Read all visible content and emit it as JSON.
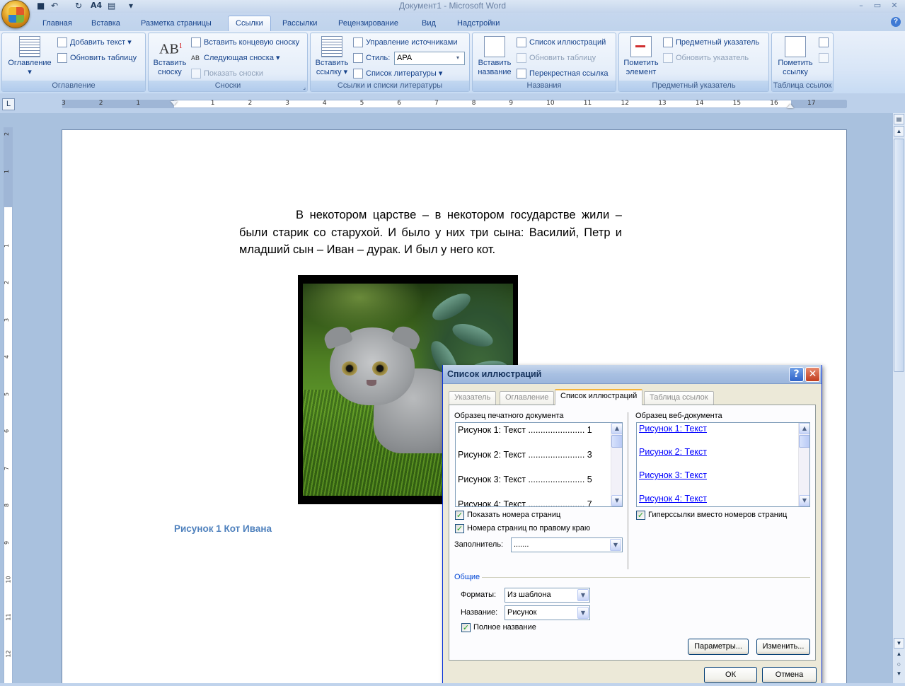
{
  "window": {
    "title": "Документ1 - Microsoft Word",
    "controls": {
      "minimize": "–",
      "restore": "▭",
      "close": "✕"
    }
  },
  "qat": {
    "save": "■",
    "undo": "↶",
    "redo": "↻",
    "font_size": "A4",
    "customize": "▾"
  },
  "tabs": [
    "Главная",
    "Вставка",
    "Разметка страницы",
    "Ссылки",
    "Рассылки",
    "Рецензирование",
    "Вид",
    "Надстройки"
  ],
  "active_tab": "Ссылки",
  "ribbon": {
    "groups": [
      {
        "label": "Оглавление",
        "big": "Оглавление",
        "small": [
          "Добавить текст",
          "Обновить таблицу"
        ]
      },
      {
        "label": "Сноски",
        "big_line1": "Вставить",
        "big_line2": "сноску",
        "small": [
          "Вставить концевую сноску",
          "Следующая сноска",
          "Показать сноски"
        ]
      },
      {
        "label": "Ссылки и списки литературы",
        "big_line1": "Вставить",
        "big_line2": "ссылку",
        "small": [
          "Управление источниками",
          "Стиль:",
          "Список литературы"
        ],
        "style_value": "APA"
      },
      {
        "label": "Названия",
        "big_line1": "Вставить",
        "big_line2": "название",
        "small": [
          "Список иллюстраций",
          "Обновить таблицу",
          "Перекрестная ссылка"
        ]
      },
      {
        "label": "Предметный указатель",
        "big_line1": "Пометить",
        "big_line2": "элемент",
        "small": [
          "Предметный указатель",
          "Обновить указатель"
        ]
      },
      {
        "label": "Таблица ссылок",
        "big_line1": "Пометить",
        "big_line2": "ссылку"
      }
    ]
  },
  "ruler": {
    "h_numbers": [
      "3",
      "2",
      "1",
      "1",
      "2",
      "3",
      "4",
      "5",
      "6",
      "7",
      "8",
      "9",
      "10",
      "11",
      "12",
      "13",
      "14",
      "15",
      "16",
      "17"
    ],
    "v_numbers": [
      "2",
      "1",
      "1",
      "2",
      "3",
      "4",
      "5",
      "6",
      "7",
      "8",
      "9",
      "10",
      "11",
      "12"
    ],
    "tab_selector": "L"
  },
  "document": {
    "paragraph": "В некотором царстве – в некотором государстве жили – были старик со старухой. И было у них три сына: Василий, Петр и младший сын – Иван – дурак. И был у него кот.",
    "caption": "Рисунок 1 Кот Ивана"
  },
  "dialog": {
    "title": "Список иллюстраций",
    "help": "?",
    "close": "✕",
    "tabs": [
      "Указатель",
      "Оглавление",
      "Список иллюстраций",
      "Таблица ссылок"
    ],
    "active_tab": "Список иллюстраций",
    "print_preview_label": "Образец печатного документа",
    "print_items": [
      "Рисунок 1: Текст ....................... 1",
      "Рисунок 2: Текст ....................... 3",
      "Рисунок 3: Текст ....................... 5",
      "Рисунок 4: Текст ....................... 7"
    ],
    "web_preview_label": "Образец веб-документа",
    "web_items": [
      "Рисунок 1: Текст",
      "Рисунок 2: Текст",
      "Рисунок 3: Текст",
      "Рисунок 4: Текст"
    ],
    "show_page_numbers": "Показать номера страниц",
    "right_align": "Номера страниц по правому краю",
    "hyperlinks": "Гиперссылки вместо номеров страниц",
    "tab_leader_label": "Заполнитель:",
    "tab_leader_value": ".......",
    "general_label": "Общие",
    "formats_label": "Форматы:",
    "formats_value": "Из шаблона",
    "caption_label": "Название:",
    "caption_value": "Рисунок",
    "full_caption": "Полное название",
    "options_button": "Параметры...",
    "modify_button": "Изменить...",
    "ok_button": "ОК",
    "cancel_button": "Отмена",
    "check_mark": "✓"
  },
  "colors": {
    "accent": "#4f81bd",
    "link": "#0000ff",
    "ribbon": "#dfe9f5"
  }
}
